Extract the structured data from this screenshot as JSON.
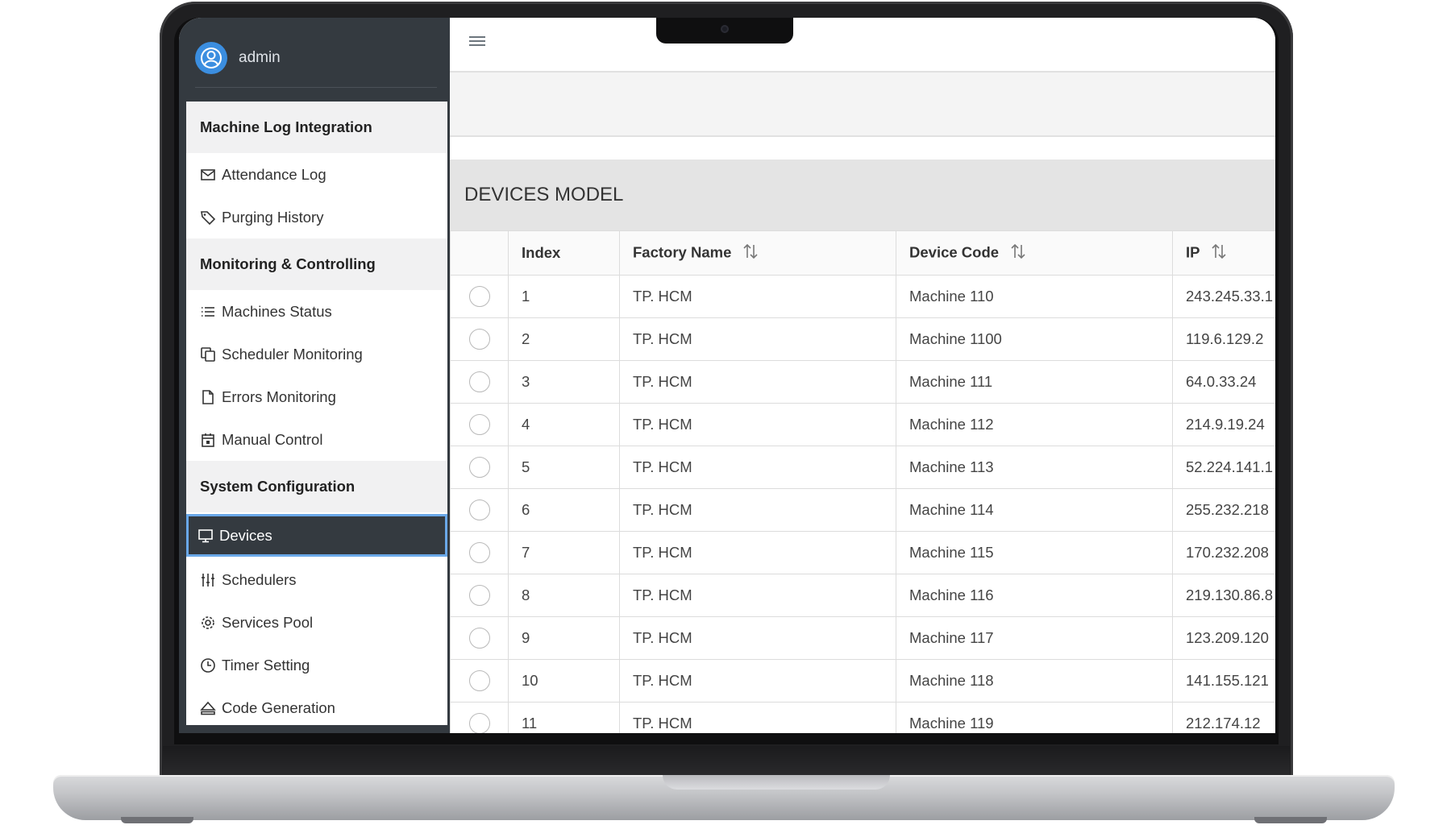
{
  "user": {
    "name": "admin"
  },
  "menu": {
    "groups": [
      {
        "title": "Machine Log Integration",
        "items": [
          {
            "label": "Attendance Log",
            "icon": "envelope-icon"
          },
          {
            "label": "Purging History",
            "icon": "tag-icon"
          }
        ]
      },
      {
        "title": "Monitoring & Controlling",
        "items": [
          {
            "label": "Machines Status",
            "icon": "list-icon"
          },
          {
            "label": "Scheduler Monitoring",
            "icon": "copy-icon"
          },
          {
            "label": "Errors Monitoring",
            "icon": "file-icon"
          },
          {
            "label": "Manual Control",
            "icon": "calendar-icon"
          }
        ]
      },
      {
        "title": "System Configuration",
        "items": [
          {
            "label": "Devices",
            "icon": "monitor-icon",
            "active": true
          },
          {
            "label": "Schedulers",
            "icon": "sliders-icon"
          },
          {
            "label": "Services Pool",
            "icon": "gear-icon"
          },
          {
            "label": "Timer Setting",
            "icon": "clock-icon"
          },
          {
            "label": "Code Generation",
            "icon": "eject-icon"
          }
        ]
      }
    ]
  },
  "page": {
    "section_title": "DEVICES MODEL"
  },
  "table": {
    "columns": [
      "Index",
      "Factory Name",
      "Device Code",
      "IP"
    ],
    "rows": [
      [
        "1",
        "TP. HCM",
        "Machine 110",
        "243.245.33.1"
      ],
      [
        "2",
        "TP. HCM",
        "Machine 1100",
        "119.6.129.2"
      ],
      [
        "3",
        "TP. HCM",
        "Machine 111",
        "64.0.33.24"
      ],
      [
        "4",
        "TP. HCM",
        "Machine 112",
        "214.9.19.24"
      ],
      [
        "5",
        "TP. HCM",
        "Machine 113",
        "52.224.141.1"
      ],
      [
        "6",
        "TP. HCM",
        "Machine 114",
        "255.232.218"
      ],
      [
        "7",
        "TP. HCM",
        "Machine 115",
        "170.232.208"
      ],
      [
        "8",
        "TP. HCM",
        "Machine 116",
        "219.130.86.8"
      ],
      [
        "9",
        "TP. HCM",
        "Machine 117",
        "123.209.120"
      ],
      [
        "10",
        "TP. HCM",
        "Machine 118",
        "141.155.121"
      ],
      [
        "11",
        "TP. HCM",
        "Machine 119",
        "212.174.12"
      ]
    ]
  }
}
